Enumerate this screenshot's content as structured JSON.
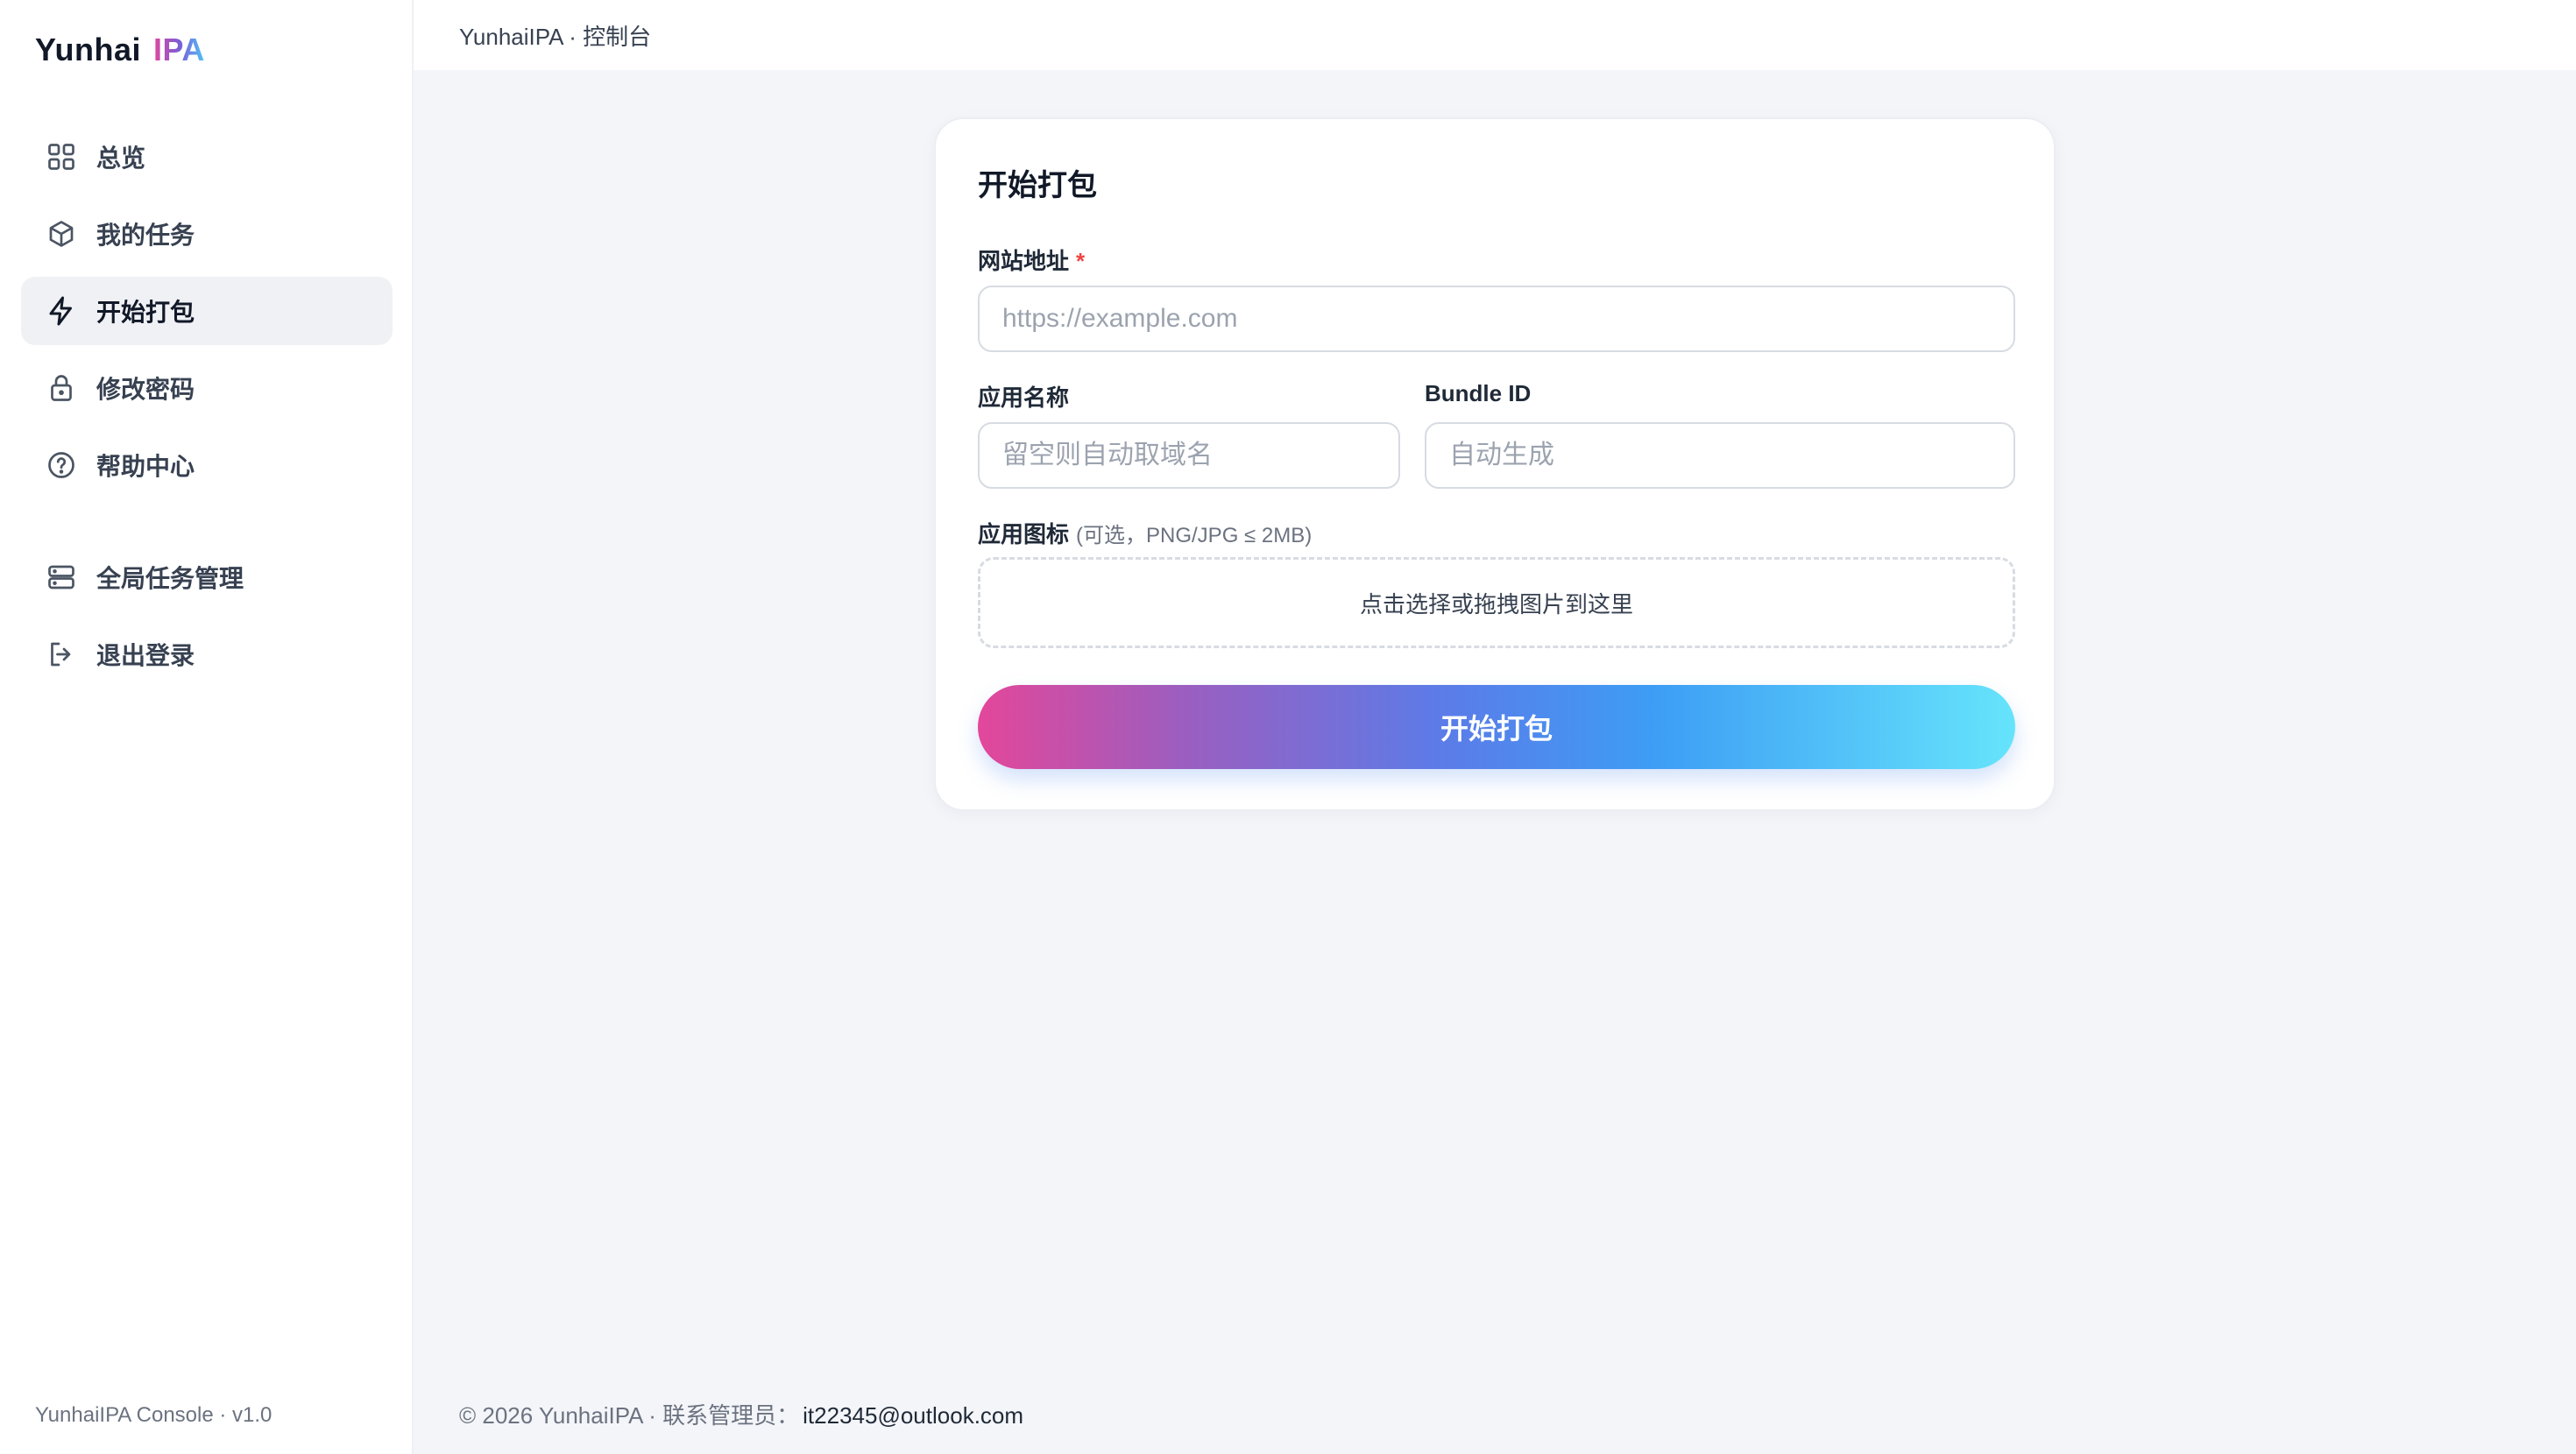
{
  "brand": {
    "name": "Yunhai",
    "accent": "IPA"
  },
  "sidebar": {
    "items": [
      {
        "label": "总览",
        "icon": "grid-icon"
      },
      {
        "label": "我的任务",
        "icon": "box-icon"
      },
      {
        "label": "开始打包",
        "icon": "lightning-icon",
        "active": true
      },
      {
        "label": "修改密码",
        "icon": "lock-icon"
      },
      {
        "label": "帮助中心",
        "icon": "help-circle-icon"
      }
    ],
    "admin_items": [
      {
        "label": "全局任务管理",
        "icon": "server-icon"
      },
      {
        "label": "退出登录",
        "icon": "logout-icon"
      }
    ],
    "footer": "YunhaiIPA Console · v1.0"
  },
  "topbar": {
    "breadcrumb": "YunhaiIPA · 控制台"
  },
  "form": {
    "title": "开始打包",
    "url_label": "网站地址",
    "required_mark": "*",
    "url_placeholder": "https://example.com",
    "name_label": "应用名称",
    "name_placeholder": "留空则自动取域名",
    "bundle_label": "Bundle ID",
    "bundle_placeholder": "自动生成",
    "icon_label": "应用图标",
    "icon_hint": "(可选，PNG/JPG ≤ 2MB)",
    "dropzone_text": "点击选择或拖拽图片到这里",
    "submit_label": "开始打包"
  },
  "footer": {
    "text": "© 2026 YunhaiIPA · 联系管理员：",
    "email": "it22345@outlook.com"
  },
  "colors": {
    "accent_pink": "#e3479a",
    "accent_blue": "#3d9df5",
    "accent_cyan": "#66e4fb",
    "required": "#ef4444"
  }
}
